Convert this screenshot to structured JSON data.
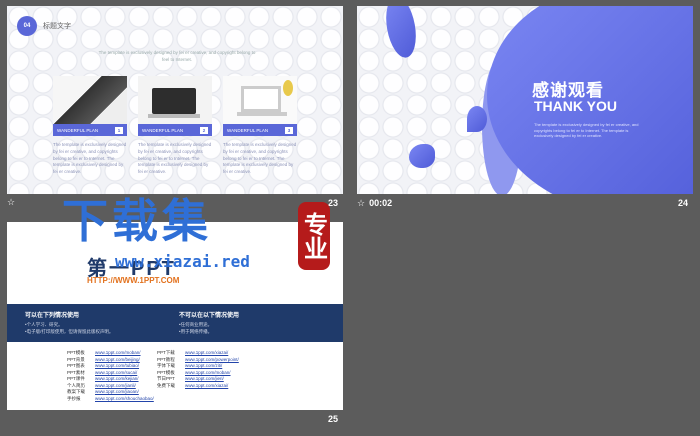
{
  "colors": {
    "accent": "#5a67d8",
    "dark_band": "#1f3a6a",
    "background": "#5c5c5c",
    "watermark": "#2f6fd6",
    "seal": "#b51b1b"
  },
  "slides": [
    {
      "number": "23",
      "time": "",
      "badge": "04",
      "title": "标题文字",
      "subtitle": "The template is exclusively designed by fei er creative, and copyright belong to feel to Internet.",
      "cards": [
        {
          "caption": "WANDERFUL  PLAN",
          "index": "1",
          "text": "The template is exclusively designed by fei er creative, and copyrights belong to fei er to Internet. The template is exclusively designed by fei er creative."
        },
        {
          "caption": "WANDERFUL  PLAN",
          "index": "2",
          "text": "The template is exclusively designed by fei er creative, and copyrights belong to fei er to Internet. The template is exclusively designed by fei er creative."
        },
        {
          "caption": "WANDERFUL  PLAN",
          "index": "3",
          "text": "The template is exclusively designed by fei er creative, and copyrights belong to fei er to Internet. The template is exclusively designed by fei er creative."
        }
      ]
    },
    {
      "number": "24",
      "time": "00:02",
      "title_cn": "感谢观看",
      "title_en": "THANK YOU",
      "small_text": "The template is exclusively designed by fei er creative, and copyrights belong to fei er to Internet. The template is exclusively designed by fei er creative."
    },
    {
      "number": "25",
      "logo": "第一PPT",
      "url": "HTTP://WWW.1PPT.COM",
      "left_title": "可以在下列情况使用",
      "left_lines": [
        "•个人学习、研究。",
        "•电子版/打印版使用，但请保留此版权声明。"
      ],
      "right_title": "不可以在以下情况使用",
      "right_lines": [
        "•任何商业用途。",
        "•用于网络传播。"
      ],
      "links_left": [
        {
          "k": "PPT模板",
          "v": "www.1ppt.com/moban/"
        },
        {
          "k": "PPT背景",
          "v": "www.1ppt.com/beijing/"
        },
        {
          "k": "PPT图表",
          "v": "www.1ppt.com/tubiao/"
        },
        {
          "k": "PPT素材",
          "v": "www.1ppt.com/sucai/"
        },
        {
          "k": "PPT课件",
          "v": "www.1ppt.com/kejian/"
        },
        {
          "k": "个人简历",
          "v": "www.1ppt.com/jianli/"
        },
        {
          "k": "教案下载",
          "v": "www.1ppt.com/jiaoan/"
        },
        {
          "k": "手抄报",
          "v": "www.1ppt.com/shouchaobao/"
        }
      ],
      "links_right": [
        {
          "k": "PPT下载",
          "v": "www.1ppt.com/xiazai/"
        },
        {
          "k": "PPT教程",
          "v": "www.1ppt.com/powerpoint/"
        },
        {
          "k": "字体下载",
          "v": "www.1ppt.com/ziti/"
        },
        {
          "k": "PPT模板",
          "v": "www.1ppt.com/moban/"
        },
        {
          "k": "节日PPT",
          "v": "www.1ppt.com/jieri/"
        },
        {
          "k": "免费下载",
          "v": "www.1ppt.com/xiazai/"
        }
      ]
    }
  ],
  "watermark": {
    "text": "下载集",
    "url": "www.xiazai.red",
    "seal": "专业"
  }
}
